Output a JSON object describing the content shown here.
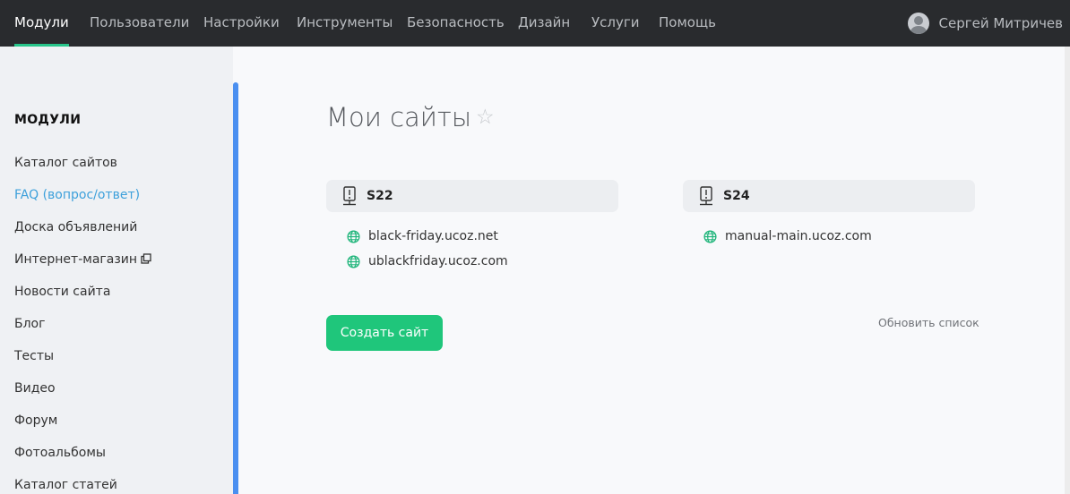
{
  "nav": {
    "items": [
      {
        "label": "Модули",
        "active": true
      },
      {
        "label": "Пользователи"
      },
      {
        "label": "Настройки"
      },
      {
        "label": "Инструменты"
      },
      {
        "label": "Безопасность"
      },
      {
        "label": "Дизайн"
      },
      {
        "label": "Услуги"
      },
      {
        "label": "Помощь"
      }
    ],
    "user_name": "Сергей Митричев"
  },
  "sidebar": {
    "title": "МОДУЛИ",
    "items": [
      {
        "label": "Каталог сайтов"
      },
      {
        "label": "FAQ (вопрос/ответ)"
      },
      {
        "label": "Доска объявлений"
      },
      {
        "label": "Интернет-магазин"
      },
      {
        "label": "Новости сайта"
      },
      {
        "label": "Блог"
      },
      {
        "label": "Тесты"
      },
      {
        "label": "Видео"
      },
      {
        "label": "Форум"
      },
      {
        "label": "Фотоальбомы"
      },
      {
        "label": "Каталог статей"
      }
    ]
  },
  "main": {
    "title": "Мои сайты",
    "servers": [
      {
        "name": "S22",
        "sites": [
          "black-friday.ucoz.net",
          "ublackfriday.ucoz.com"
        ]
      },
      {
        "name": "S24",
        "sites": [
          "manual-main.ucoz.com"
        ]
      }
    ],
    "create_button": "Создать сайт",
    "refresh_link": "Обновить список"
  },
  "colors": {
    "nav_bg": "#292b2e",
    "accent_green": "#1fc67b",
    "link_blue": "#3da0db",
    "scroll_blue": "#4a8ff0"
  }
}
